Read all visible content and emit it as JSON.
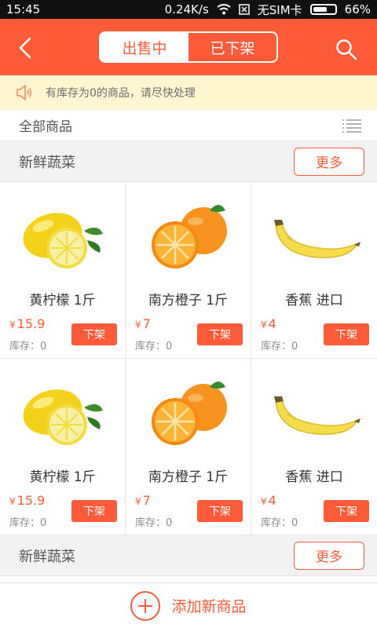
{
  "status": {
    "time": "15:45",
    "speed": "0.24K/s",
    "carrier": "无SIM卡",
    "battery": "66%",
    "battery_level": 0.66
  },
  "header": {
    "tabs": [
      "出售中",
      "已下架"
    ],
    "active_tab": 0
  },
  "notice": {
    "text": "有库存为0的商品，请尽快处理"
  },
  "all_products": {
    "label": "全部商品"
  },
  "sections": [
    {
      "title": "新鲜蔬菜",
      "more_label": "更多",
      "items": [
        {
          "name": "黄柠檬  1斤",
          "price": "15.9",
          "stock": "库存：0",
          "action": "下架",
          "image": "lemon"
        },
        {
          "name": "南方橙子  1斤",
          "price": "7",
          "stock": "库存：0",
          "action": "下架",
          "image": "orange"
        },
        {
          "name": "香蕉  进口",
          "price": "4",
          "stock": "库存：0",
          "action": "下架",
          "image": "banana"
        },
        {
          "name": "黄柠檬  1斤",
          "price": "15.9",
          "stock": "库存：0",
          "action": "下架",
          "image": "lemon"
        },
        {
          "name": "南方橙子  1斤",
          "price": "7",
          "stock": "库存：0",
          "action": "下架",
          "image": "orange"
        },
        {
          "name": "香蕉  进口",
          "price": "4",
          "stock": "库存：0",
          "action": "下架",
          "image": "banana"
        }
      ]
    },
    {
      "title": "新鲜蔬菜",
      "more_label": "更多",
      "items": []
    }
  ],
  "currency_symbol": "¥",
  "footer": {
    "add_label": "添加新商品"
  },
  "colors": {
    "accent": "#ff5b38",
    "notice_bg": "#fff6cf"
  }
}
